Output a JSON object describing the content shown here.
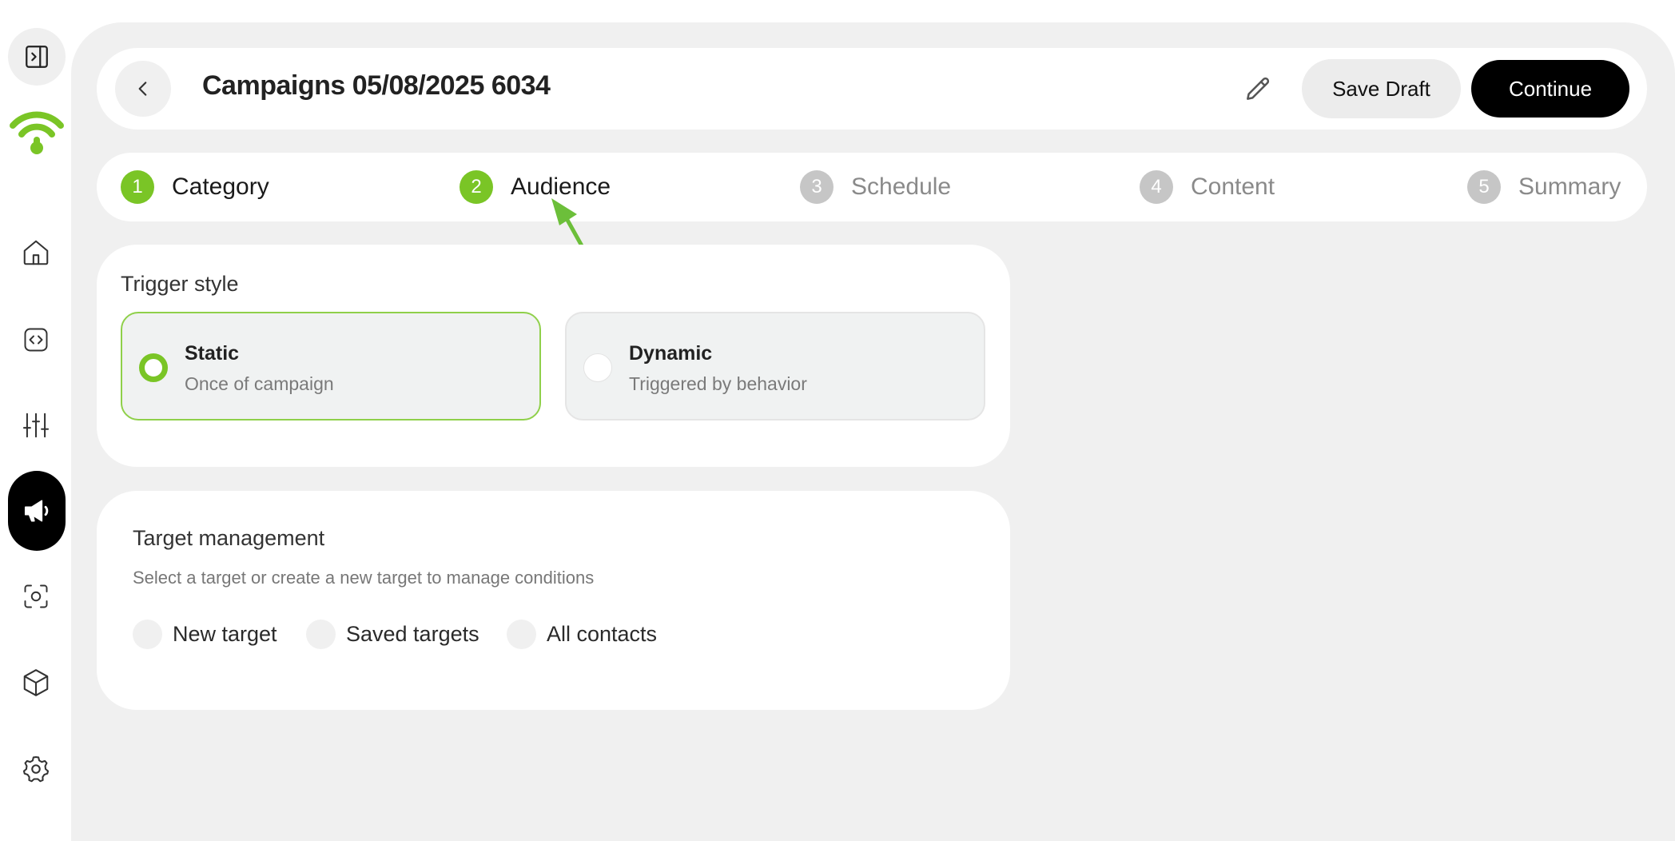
{
  "header": {
    "title": "Campaigns 05/08/2025 6034",
    "save_draft_label": "Save Draft",
    "continue_label": "Continue"
  },
  "steps": [
    {
      "number": "1",
      "label": "Category",
      "state": "done"
    },
    {
      "number": "2",
      "label": "Audience",
      "state": "current"
    },
    {
      "number": "3",
      "label": "Schedule",
      "state": "todo"
    },
    {
      "number": "4",
      "label": "Content",
      "state": "todo"
    },
    {
      "number": "5",
      "label": "Summary",
      "state": "todo"
    }
  ],
  "trigger": {
    "title": "Trigger style",
    "options": [
      {
        "title": "Static",
        "subtitle": "Once of campaign",
        "selected": true
      },
      {
        "title": "Dynamic",
        "subtitle": "Triggered by behavior",
        "selected": false
      }
    ]
  },
  "target": {
    "title": "Target management",
    "subtitle": "Select a target or create a new target to manage conditions",
    "choices": [
      {
        "label": "New target"
      },
      {
        "label": "Saved targets"
      },
      {
        "label": "All contacts"
      }
    ]
  },
  "sidebar": {
    "icons": [
      "panel-toggle-icon",
      "wifi-logo-icon",
      "home-icon",
      "code-icon",
      "sliders-icon",
      "megaphone-icon",
      "scan-icon",
      "cube-icon",
      "gear-icon"
    ],
    "active": "megaphone-icon"
  },
  "colors": {
    "accent": "#7ac526",
    "primary_button": "#000000",
    "panel_background": "#f0f0f0"
  }
}
